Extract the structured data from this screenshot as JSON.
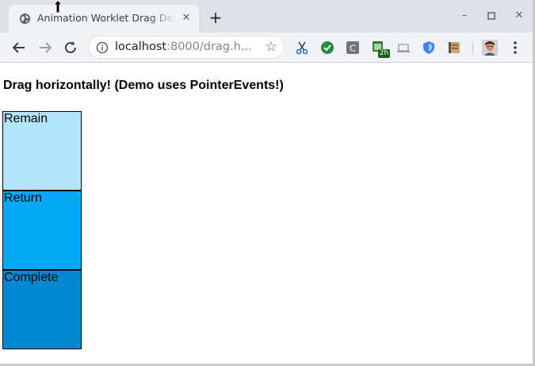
{
  "tab": {
    "title": "Animation Worklet Drag Demo",
    "favicon": "globe-icon",
    "close_icon": "close-icon"
  },
  "window_controls": {
    "minimize": "–",
    "maximize": "▫",
    "close": "✕"
  },
  "omnibox": {
    "host": "localhost",
    "rest": ":8000/drag.h..."
  },
  "extensions": [
    "scissors-icon",
    "check-shield-icon",
    "c-letter-icon",
    "calendar-2h-icon",
    "laptop-icon",
    "shield-icon",
    "book-icon",
    "avatar"
  ],
  "extension_badge": "2h",
  "page": {
    "heading": "Drag horizontally! (Demo uses PointerEvents!)",
    "boxes": [
      {
        "label": "Remain",
        "color": "#b3e5fc"
      },
      {
        "label": "Return",
        "color": "#03a9f4"
      },
      {
        "label": "Complete",
        "color": "#0288d1"
      }
    ]
  }
}
